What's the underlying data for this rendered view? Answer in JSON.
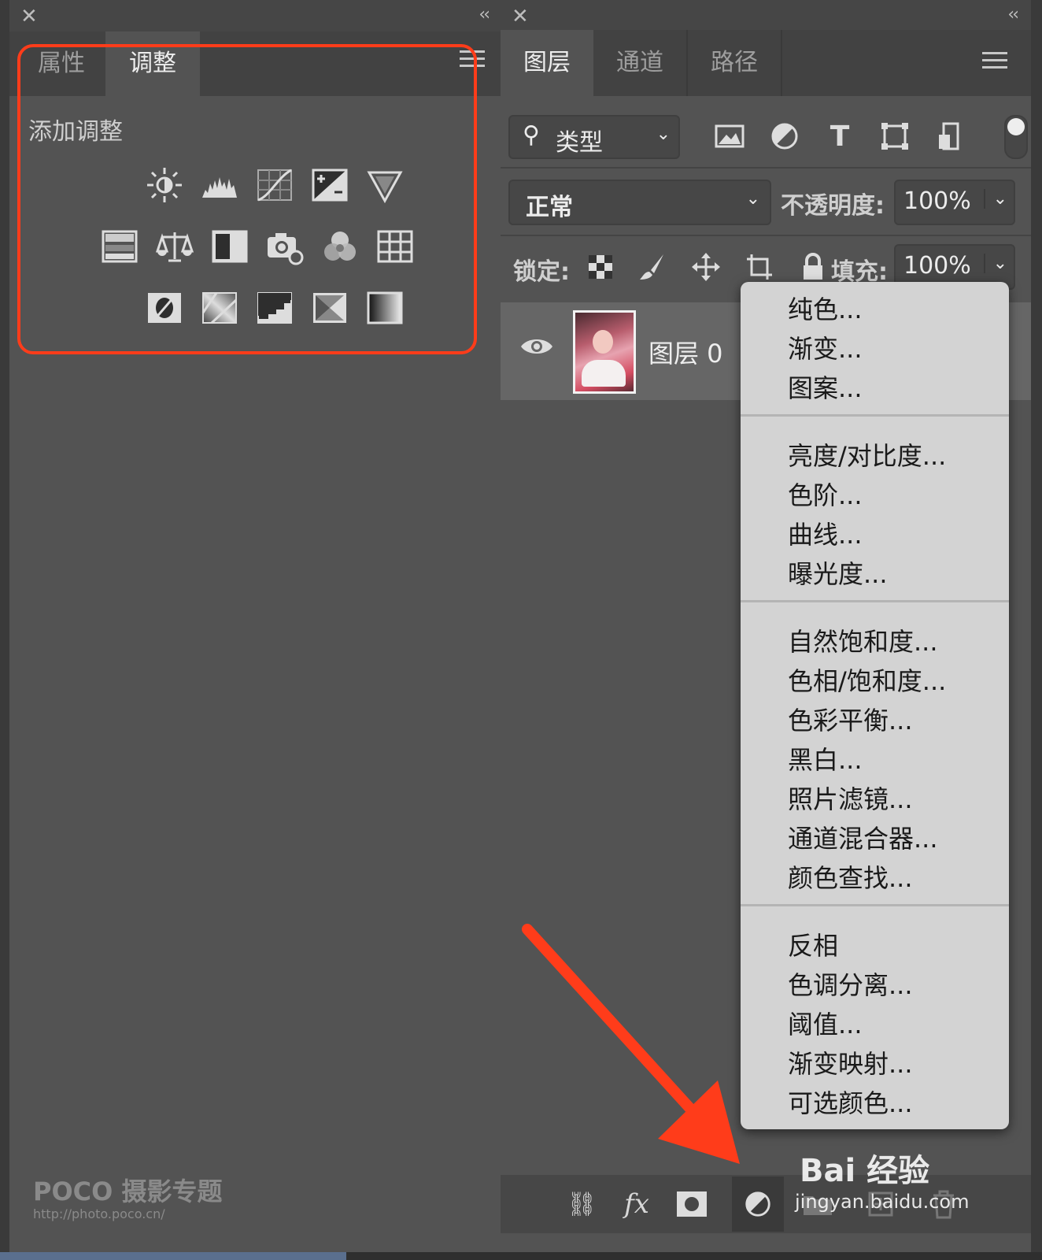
{
  "left_panel": {
    "tabs": [
      {
        "label": "属性"
      },
      {
        "label": "调整"
      }
    ],
    "section_title": "添加调整",
    "adjustment_icons": {
      "row1": [
        "brightness-contrast-icon",
        "levels-icon",
        "curves-icon",
        "exposure-icon",
        "vibrance-icon"
      ],
      "row2": [
        "hue-saturation-icon",
        "color-balance-icon",
        "black-white-icon",
        "photo-filter-icon",
        "channel-mixer-icon",
        "color-lookup-icon"
      ],
      "row3": [
        "invert-icon",
        "posterize-icon",
        "threshold-icon",
        "selective-color-icon",
        "gradient-map-icon"
      ]
    },
    "watermark": {
      "brand": "POCO 摄影专题",
      "url": "http://photo.poco.cn/"
    }
  },
  "right_panel": {
    "tabs": [
      {
        "label": "图层"
      },
      {
        "label": "通道"
      },
      {
        "label": "路径"
      }
    ],
    "filter": {
      "label": "类型"
    },
    "blend_mode": "正常",
    "opacity_label": "不透明度:",
    "opacity_value": "100%",
    "lock_label": "锁定:",
    "fill_label": "填充:",
    "fill_value": "100%",
    "layers": [
      {
        "name": "图层 0",
        "visible": true
      }
    ]
  },
  "context_menu": {
    "groups": [
      [
        "纯色...",
        "渐变...",
        "图案..."
      ],
      [
        "亮度/对比度...",
        "色阶...",
        "曲线...",
        "曝光度..."
      ],
      [
        "自然饱和度...",
        "色相/饱和度...",
        "色彩平衡...",
        "黑白...",
        "照片滤镜...",
        "通道混合器...",
        "颜色查找..."
      ],
      [
        "反相",
        "色调分离...",
        "阈值...",
        "渐变映射...",
        "可选颜色..."
      ]
    ]
  },
  "watermark_baidu": {
    "brand": "Bai 经验",
    "url": "jingyan.baidu.com"
  },
  "colors": {
    "annotation_red": "#ff3c1a",
    "panel_bg": "#535353",
    "menu_bg": "#d3d3d3"
  }
}
